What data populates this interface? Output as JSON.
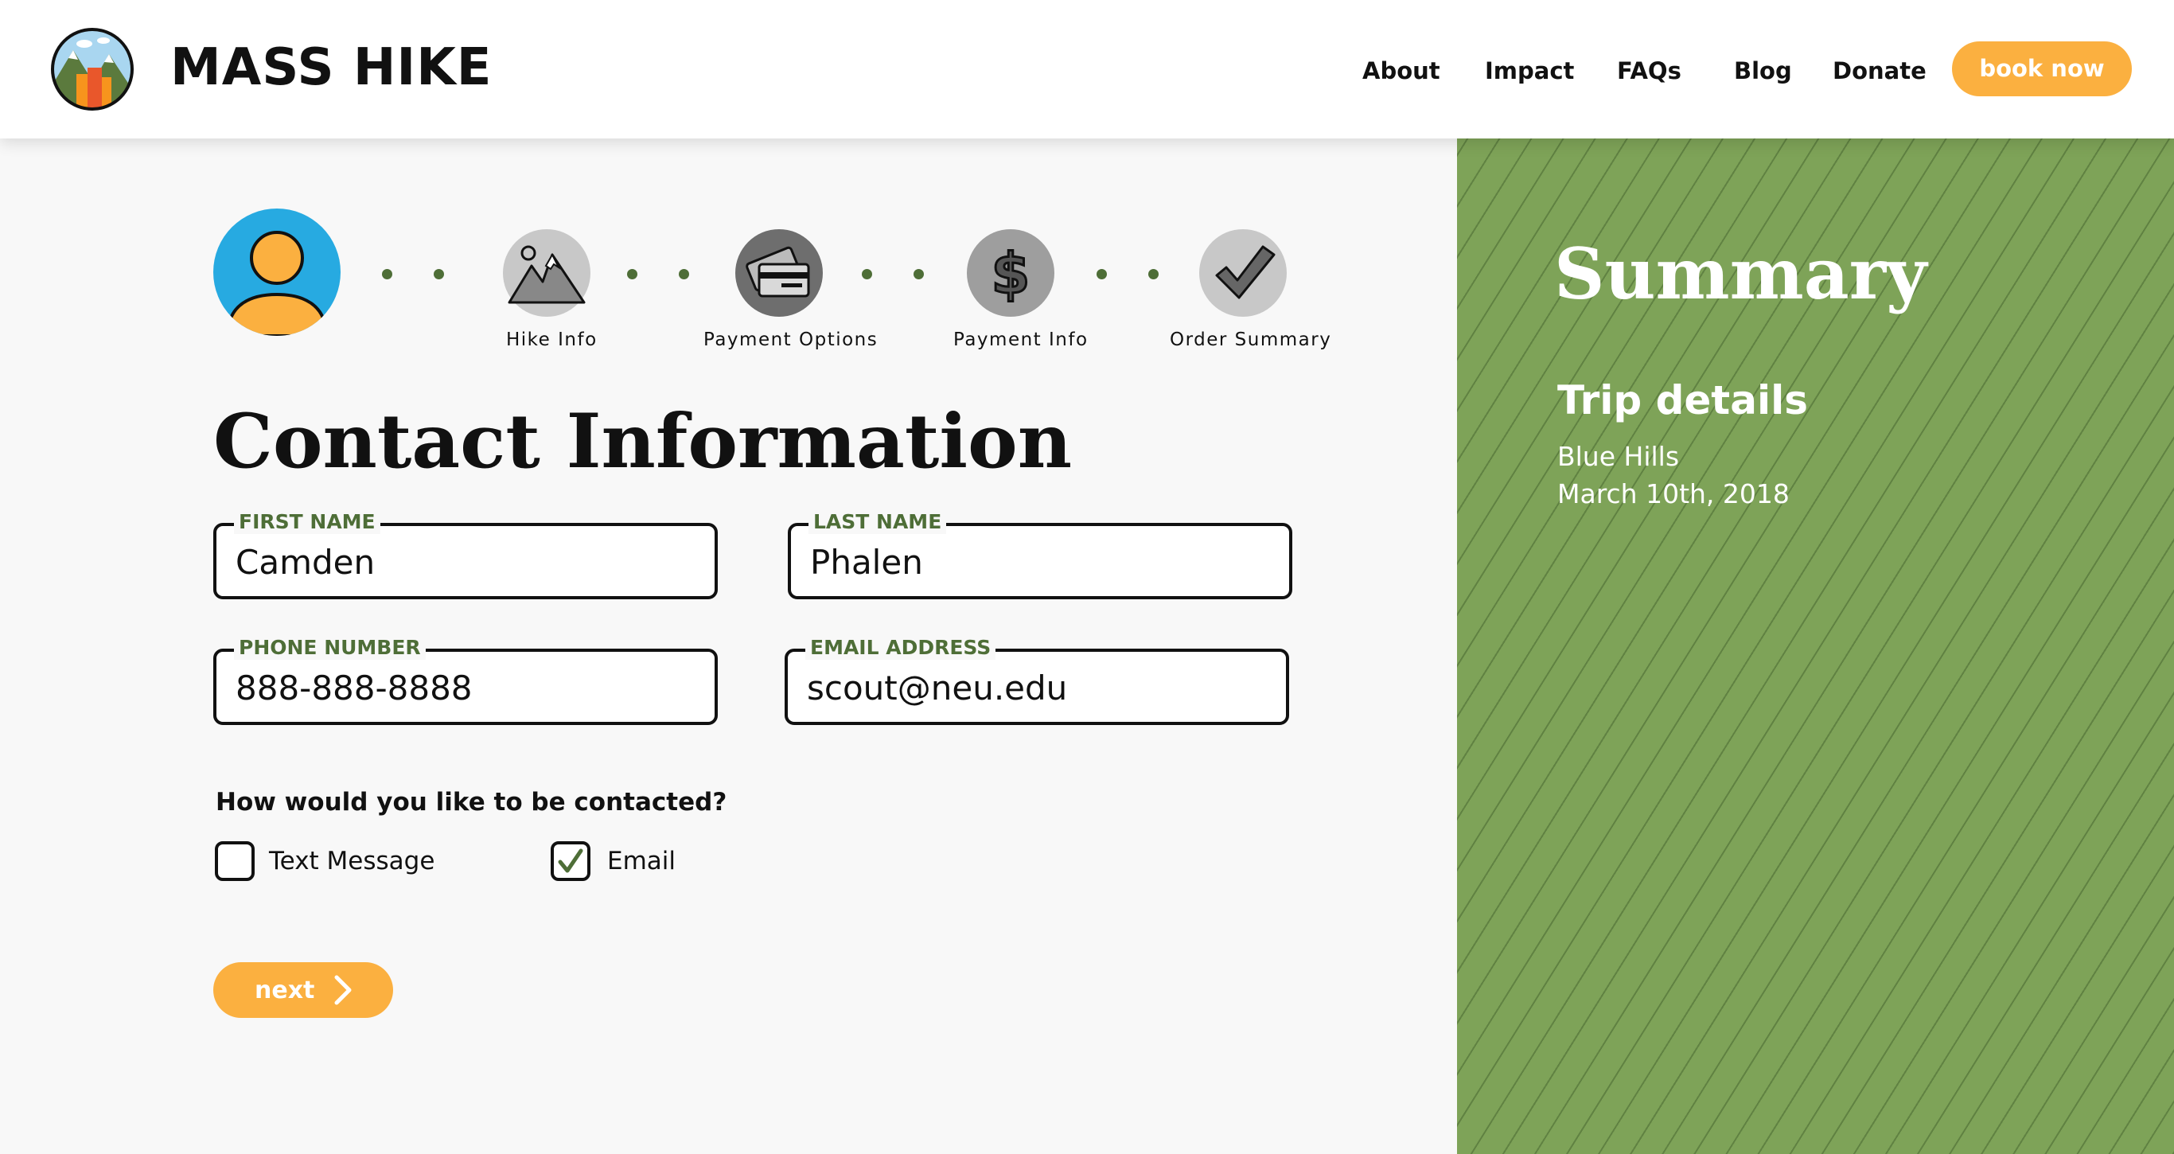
{
  "header": {
    "brand": "MASS HIKE",
    "nav": [
      "About",
      "Impact",
      "FAQs",
      "Blog",
      "Donate"
    ],
    "cta": "book now"
  },
  "stepper": {
    "steps": [
      {
        "label": "",
        "icon": "person-icon",
        "active": true
      },
      {
        "label": "Hike Info",
        "icon": "mountain-icon"
      },
      {
        "label": "Payment Options",
        "icon": "credit-card-icon"
      },
      {
        "label": "Payment Info",
        "icon": "dollar-icon"
      },
      {
        "label": "Order Summary",
        "icon": "checkmark-icon"
      }
    ]
  },
  "form": {
    "title": "Contact Information",
    "first_name": {
      "label": "FIRST NAME",
      "value": "Camden"
    },
    "last_name": {
      "label": "LAST NAME",
      "value": "Phalen"
    },
    "phone": {
      "label": "PHONE NUMBER",
      "value": "888-888-8888"
    },
    "email": {
      "label": "EMAIL ADDRESS",
      "value": "scout@neu.edu"
    },
    "contact_question": "How would you like to be contacted?",
    "options": [
      {
        "label": "Text Message",
        "checked": false
      },
      {
        "label": "Email",
        "checked": true
      }
    ],
    "next_label": "next"
  },
  "summary": {
    "title": "Summary",
    "trip_title": "Trip details",
    "trip_location": "Blue Hills",
    "trip_date": "March 10th, 2018"
  },
  "colors": {
    "accent": "#fbb040",
    "green": "#7ea358",
    "dark_green": "#4e6e37",
    "avatar_bg": "#27aae1"
  }
}
